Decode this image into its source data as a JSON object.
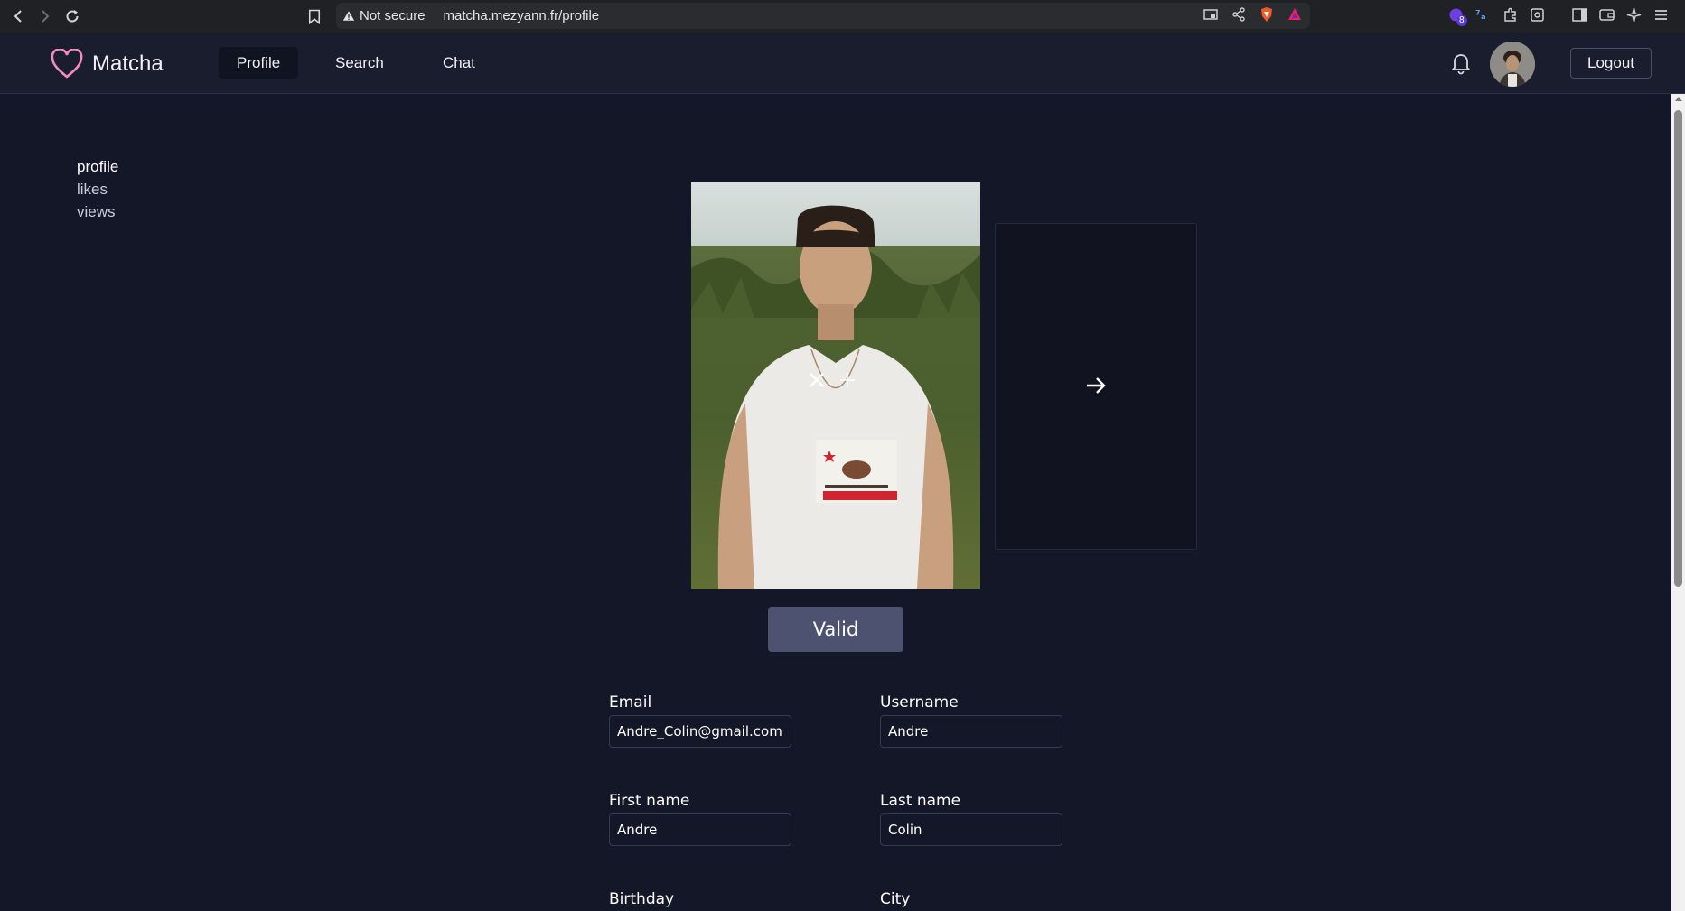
{
  "browser": {
    "back_icon": "arrow-left-icon",
    "forward_icon": "arrow-right-icon",
    "reload_icon": "reload-icon",
    "security_label": "Not secure",
    "url": "matcha.mezyann.fr/profile",
    "extension_badge": "8"
  },
  "nav": {
    "brand": "Matcha",
    "brand_color": "#f08cc0",
    "tabs": [
      {
        "label": "Profile",
        "active": true
      },
      {
        "label": "Search",
        "active": false
      },
      {
        "label": "Chat",
        "active": false
      }
    ],
    "logout_label": "Logout"
  },
  "side_menu": {
    "items": [
      {
        "label": "profile",
        "active": true
      },
      {
        "label": "likes",
        "active": false
      },
      {
        "label": "views",
        "active": false
      }
    ]
  },
  "photos": {
    "remove_icon": "close-icon",
    "add_icon": "plus-icon",
    "next_icon": "arrow-right-icon",
    "valid_label": "Valid"
  },
  "form": {
    "email_label": "Email",
    "email_value": "Andre_Colin@gmail.com",
    "username_label": "Username",
    "username_value": "Andre",
    "firstname_label": "First name",
    "firstname_value": "Andre",
    "lastname_label": "Last name",
    "lastname_value": "Colin",
    "birthday_label": "Birthday",
    "city_label": "City"
  }
}
